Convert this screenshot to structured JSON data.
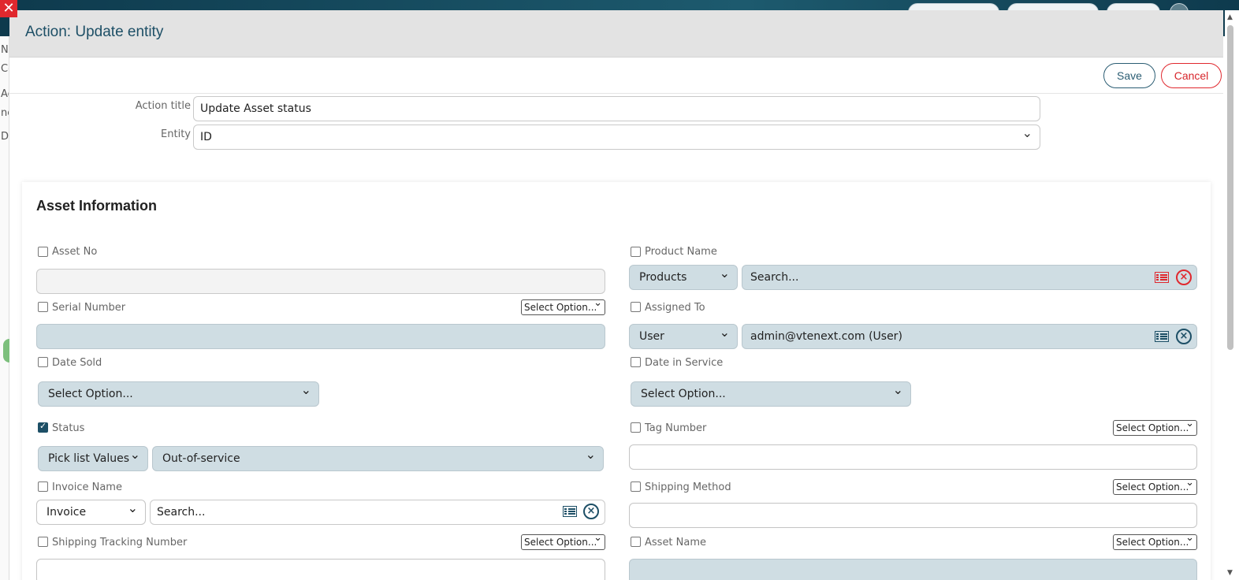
{
  "modal": {
    "title": "Action: Update entity",
    "close_glyph": "✕",
    "save_label": "Save",
    "cancel_label": "Cancel"
  },
  "background": {
    "left_fragments": [
      "N",
      "Co",
      "Ac",
      "nc",
      "D"
    ]
  },
  "form": {
    "action_title_label": "Action title",
    "action_title_value": "Update Asset status",
    "entity_label": "Entity",
    "entity_value": "ID"
  },
  "section": {
    "title": "Asset Information",
    "fields": {
      "asset_no": {
        "label": "Asset No",
        "checked": false
      },
      "product_name": {
        "label": "Product Name",
        "checked": false,
        "module": "Products",
        "placeholder": "Search..."
      },
      "serial_number": {
        "label": "Serial Number",
        "checked": false,
        "option": "Select Option..."
      },
      "assigned_to": {
        "label": "Assigned To",
        "checked": false,
        "type": "User",
        "value": "admin@vtenext.com (User)"
      },
      "date_sold": {
        "label": "Date Sold",
        "checked": false,
        "option": "Select Option..."
      },
      "date_in_service": {
        "label": "Date in Service",
        "checked": false,
        "option": "Select Option..."
      },
      "status": {
        "label": "Status",
        "checked": true,
        "source": "Pick list Values",
        "value": "Out-of-service"
      },
      "tag_number": {
        "label": "Tag Number",
        "checked": false,
        "option": "Select Option..."
      },
      "invoice_name": {
        "label": "Invoice Name",
        "checked": false,
        "module": "Invoice",
        "placeholder": "Search..."
      },
      "shipping_method": {
        "label": "Shipping Method",
        "checked": false,
        "option": "Select Option..."
      },
      "shipping_tracking_number": {
        "label": "Shipping Tracking Number",
        "checked": false,
        "option": "Select Option..."
      },
      "asset_name": {
        "label": "Asset Name",
        "checked": false,
        "option": "Select Option..."
      }
    }
  },
  "icons": {
    "list": "list-icon",
    "clear": "clear-circle-icon",
    "close": "close-icon"
  },
  "colors": {
    "accent": "#1d4f66",
    "danger": "#e0282e",
    "field_fill": "#cfdde3"
  }
}
